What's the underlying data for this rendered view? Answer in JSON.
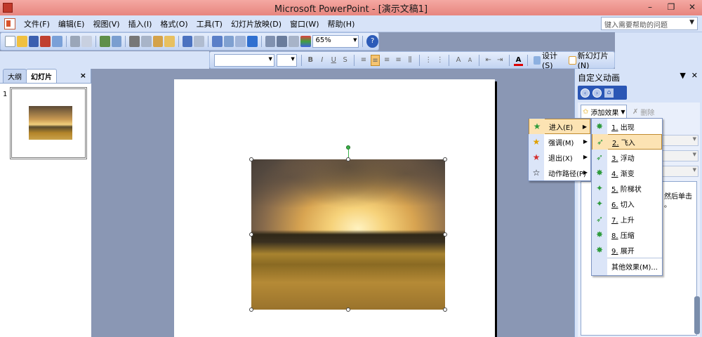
{
  "titlebar": {
    "title": "Microsoft PowerPoint - [演示文稿1]"
  },
  "menubar": {
    "items": [
      "文件(F)",
      "编辑(E)",
      "视图(V)",
      "插入(I)",
      "格式(O)",
      "工具(T)",
      "幻灯片放映(D)",
      "窗口(W)",
      "帮助(H)"
    ],
    "help_placeholder": "键入需要帮助的问题"
  },
  "toolbar": {
    "zoom": "65%",
    "design_label": "设计(S)",
    "new_slide_label": "新幻灯片(N)"
  },
  "left_panel": {
    "tab_outline": "大纲",
    "tab_slides": "幻灯片",
    "slide_number": "1"
  },
  "task_pane": {
    "title": "自定义动画",
    "add_effect": "添加效果",
    "remove": "删除",
    "note": "然后单击\n。"
  },
  "effect_menu": {
    "items": [
      {
        "label": "进入(E)",
        "icon": "enter-star-icon"
      },
      {
        "label": "强调(M)",
        "icon": "emphasis-star-icon"
      },
      {
        "label": "退出(X)",
        "icon": "exit-star-icon"
      },
      {
        "label": "动作路径(P)",
        "icon": "motion-path-star-icon"
      }
    ]
  },
  "entrance_submenu": {
    "items": [
      {
        "num": "1.",
        "label": "出现"
      },
      {
        "num": "2.",
        "label": "飞入"
      },
      {
        "num": "3.",
        "label": "浮动"
      },
      {
        "num": "4.",
        "label": "渐变"
      },
      {
        "num": "5.",
        "label": "阶梯状"
      },
      {
        "num": "6.",
        "label": "切入"
      },
      {
        "num": "7.",
        "label": "上升"
      },
      {
        "num": "8.",
        "label": "压缩"
      },
      {
        "num": "9.",
        "label": "展开"
      }
    ],
    "more": "其他效果(M)...",
    "selected_index": 1
  },
  "colors": {
    "titlebar": "#e7857e",
    "chrome": "#d7e3f8",
    "workspace": "#8a97b4",
    "highlight": "#fce3b3"
  }
}
